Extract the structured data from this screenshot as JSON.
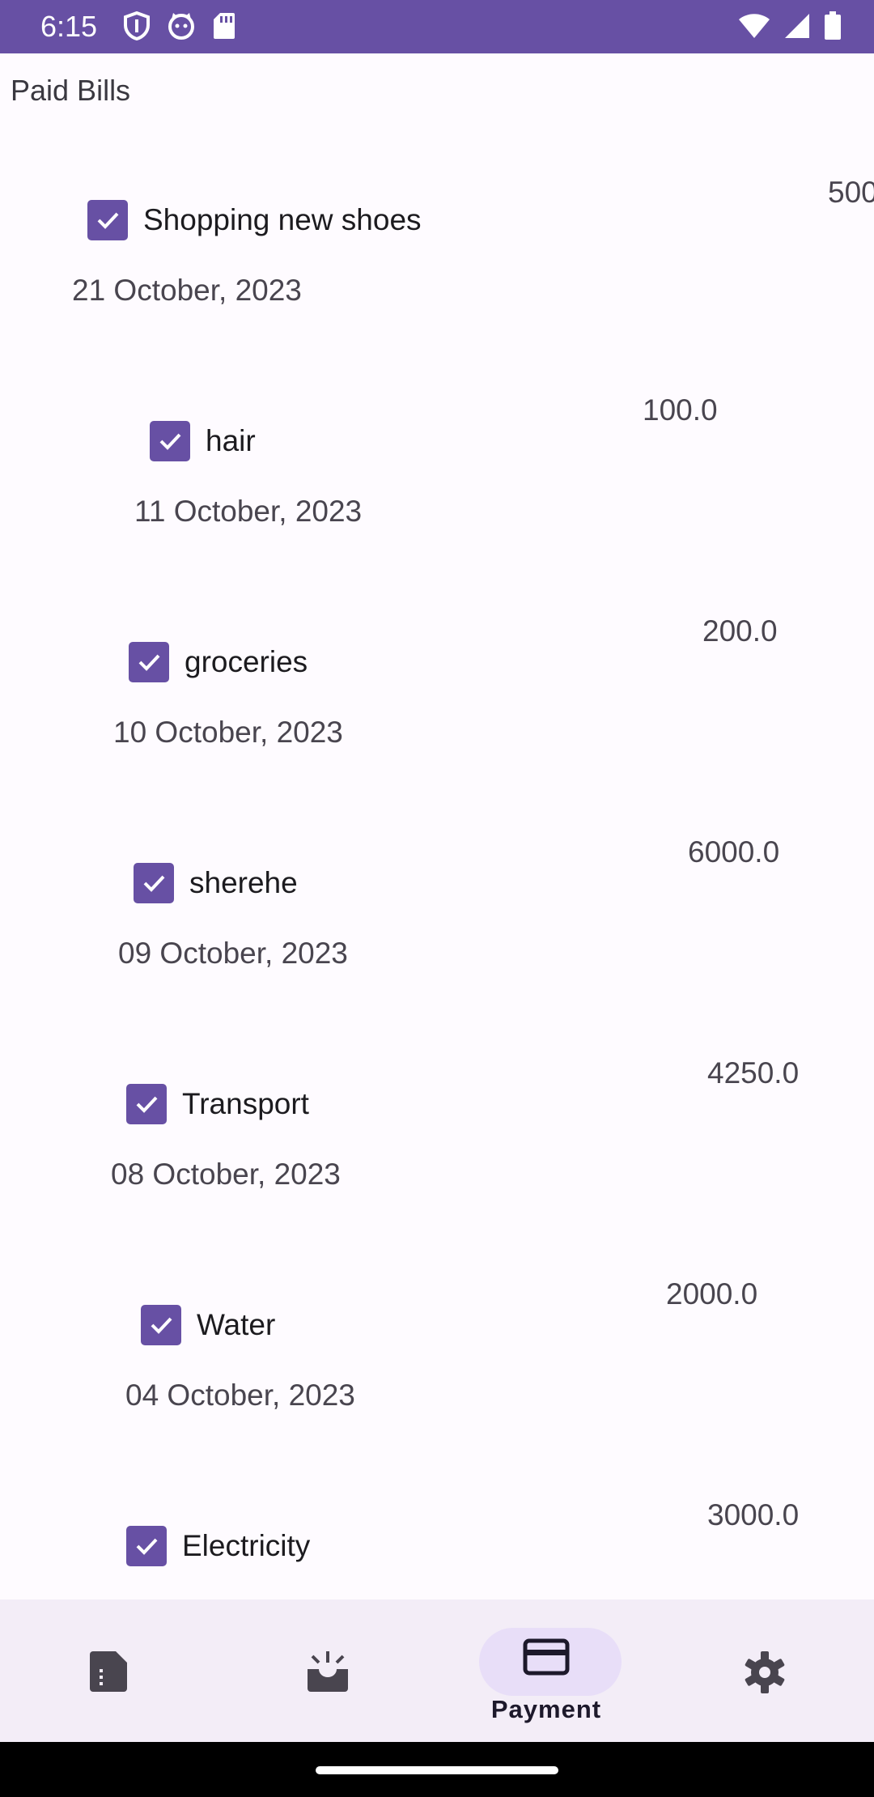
{
  "status_bar": {
    "time": "6:15",
    "left_icons": [
      "shield-icon",
      "cat-icon",
      "sd-card-icon"
    ],
    "right_icons": [
      "wifi-icon",
      "signal-icon",
      "battery-icon"
    ]
  },
  "page": {
    "title": "Paid Bills"
  },
  "bills": [
    {
      "name": "Shopping new shoes",
      "date": "21 October, 2023",
      "amount": "500",
      "checked": true
    },
    {
      "name": "hair",
      "date": "11 October, 2023",
      "amount": "100.0",
      "checked": true
    },
    {
      "name": "groceries",
      "date": "10 October, 2023",
      "amount": "200.0",
      "checked": true
    },
    {
      "name": "sherehe",
      "date": "09 October, 2023",
      "amount": "6000.0",
      "checked": true
    },
    {
      "name": "Transport",
      "date": "08 October, 2023",
      "amount": "4250.0",
      "checked": true
    },
    {
      "name": "Water",
      "date": "04 October, 2023",
      "amount": "2000.0",
      "checked": true
    },
    {
      "name": "Electricity",
      "date": "",
      "amount": "3000.0",
      "checked": true
    }
  ],
  "bottom_nav": {
    "items": [
      {
        "icon": "document-icon",
        "label": ""
      },
      {
        "icon": "inbox-icon",
        "label": ""
      },
      {
        "icon": "credit-card-icon",
        "label": "Payment",
        "active": true
      },
      {
        "icon": "gear-icon",
        "label": ""
      }
    ]
  },
  "colors": {
    "primary": "#6750a4",
    "nav_bg": "#f3edf7",
    "active_pill": "#e8def8"
  }
}
